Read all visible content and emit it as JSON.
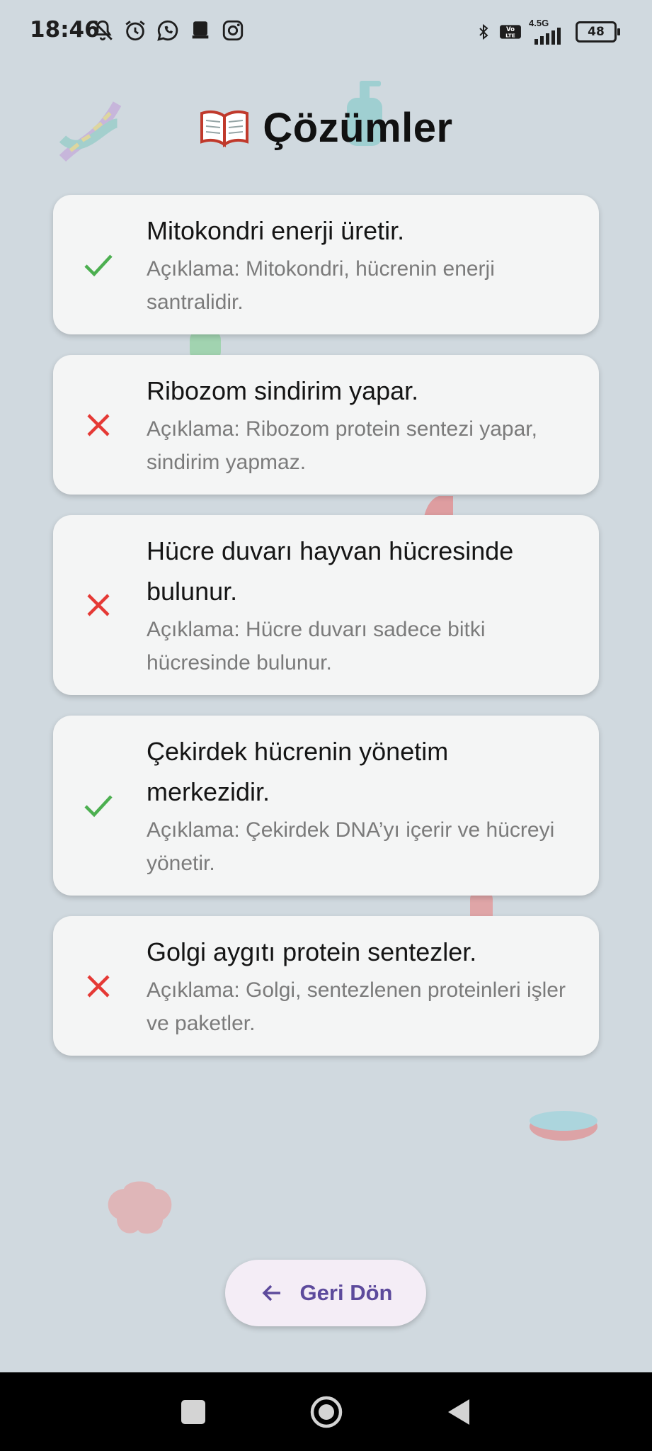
{
  "status_bar": {
    "time": "18:46",
    "left_icons": [
      "muted-bell-icon",
      "alarm-icon",
      "whatsapp-icon",
      "app-icon",
      "instagram-icon"
    ],
    "network_label": "4.5G",
    "volte_label": "Vo LTE",
    "battery": "48"
  },
  "header": {
    "emoji": "book-icon",
    "title": "Çözümler"
  },
  "answers": [
    {
      "correct": true,
      "statement": "Mitokondri enerji üretir.",
      "explanation": "Açıklama: Mitokondri, hücrenin enerji santralidir."
    },
    {
      "correct": false,
      "statement": "Ribozom sindirim yapar.",
      "explanation": "Açıklama: Ribozom protein sentezi yapar, sindirim yapmaz."
    },
    {
      "correct": false,
      "statement": "Hücre duvarı hayvan hücresinde bulunur.",
      "explanation": "Açıklama: Hücre duvarı sadece bitki hücresinde bulunur."
    },
    {
      "correct": true,
      "statement": "Çekirdek hücrenin yönetim merkezidir.",
      "explanation": "Açıklama: Çekirdek DNA’yı içerir ve hücreyi yönetir."
    },
    {
      "correct": false,
      "statement": "Golgi aygıtı protein sentezler.",
      "explanation": "Açıklama: Golgi, sentezlenen proteinleri işler ve paketler."
    }
  ],
  "back_button": {
    "label": "Geri Dön",
    "icon": "arrow-left-icon"
  },
  "colors": {
    "background": "#d0d9df",
    "card": "#f4f5f5",
    "correct": "#4caf50",
    "wrong": "#e53935",
    "button_text": "#5d4a9c"
  },
  "nav_bar": {
    "buttons": [
      "recents-square-icon",
      "home-circle-icon",
      "back-triangle-icon"
    ]
  }
}
